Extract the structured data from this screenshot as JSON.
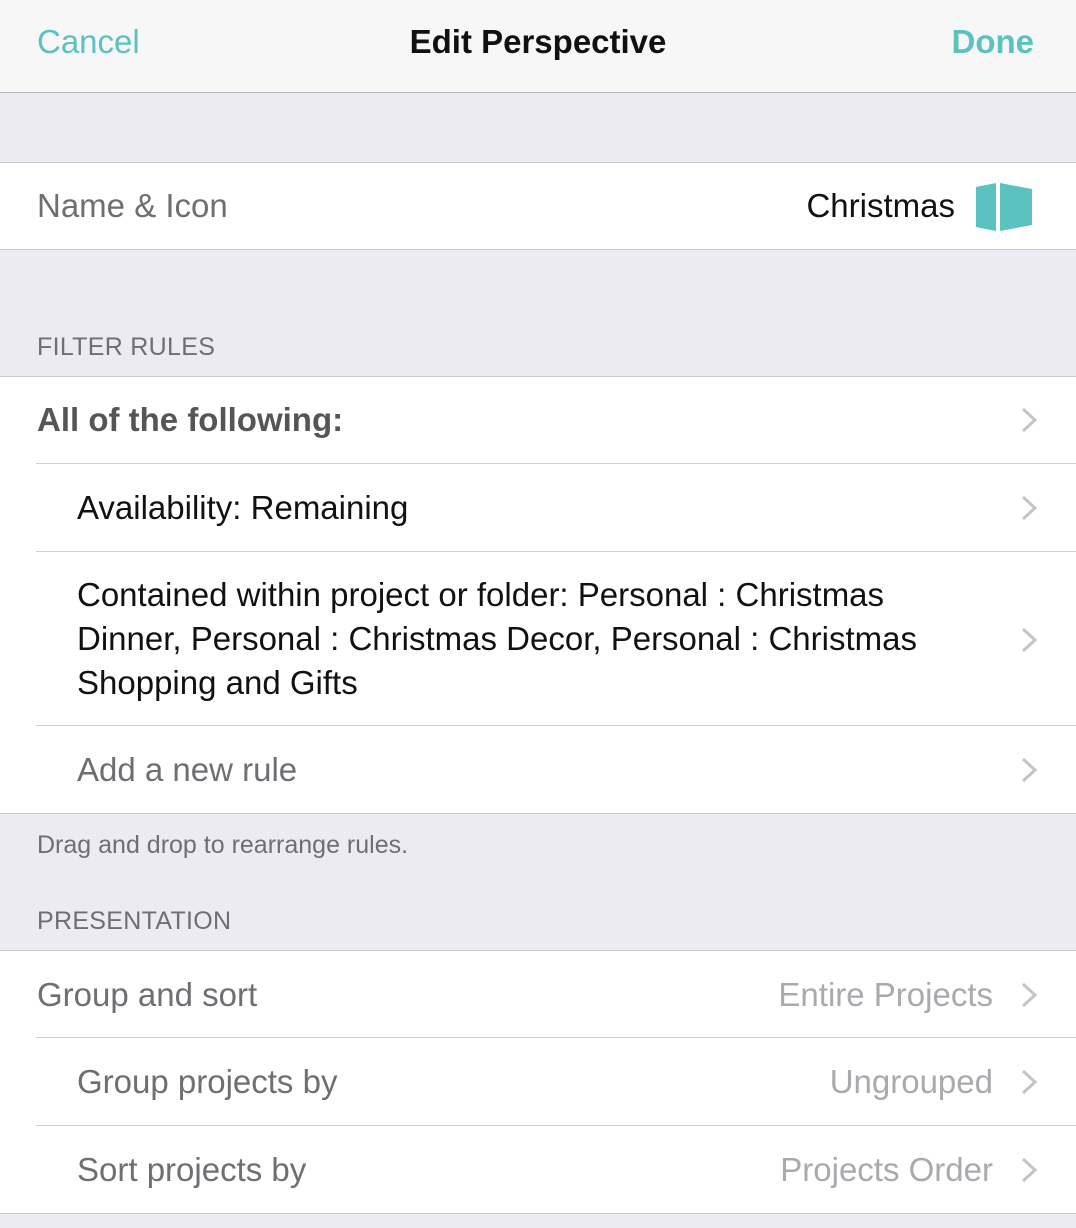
{
  "navbar": {
    "cancel_label": "Cancel",
    "title": "Edit Perspective",
    "done_label": "Done"
  },
  "name_icon": {
    "label": "Name & Icon",
    "value": "Christmas",
    "icon": "perspective-book-icon"
  },
  "filter_rules": {
    "header": "FILTER RULES",
    "group_label": "All of the following:",
    "rules": [
      "Availability: Remaining",
      "Contained within project or folder: Personal : Christmas Dinner, Personal : Christmas Decor, Personal : Christmas Shopping and Gifts"
    ],
    "add_rule_label": "Add a new rule",
    "footer": "Drag and drop to rearrange rules."
  },
  "presentation": {
    "header": "PRESENTATION",
    "rows": [
      {
        "label": "Group and sort",
        "value": "Entire Projects"
      },
      {
        "label": "Group projects by",
        "value": "Ungrouped"
      },
      {
        "label": "Sort projects by",
        "value": "Projects Order"
      }
    ]
  },
  "colors": {
    "accent": "#5cc2c0",
    "background": "#ebebf1",
    "secondary_text": "#6e6e73",
    "detail_text": "#a9a9ae"
  }
}
